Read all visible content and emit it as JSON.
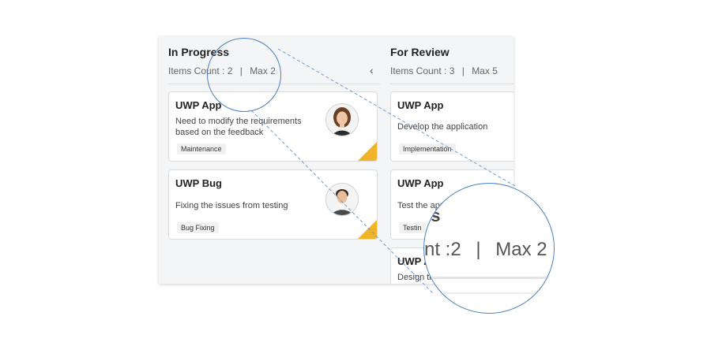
{
  "columns": [
    {
      "title": "In Progress",
      "count_label": "Items Count : 2",
      "separator": "|",
      "max_label": "Max 2",
      "cards": [
        {
          "title": "UWP App",
          "desc_lines": [
            "Need to modify the requirements",
            "based on the feedback"
          ],
          "tag": "Maintenance",
          "avatar": "female-avatar"
        },
        {
          "title": "UWP Bug",
          "desc_lines": [
            "Fixing the issues from testing"
          ],
          "tag": "Bug Fixing",
          "avatar": "male-avatar"
        }
      ]
    },
    {
      "title": "For Review",
      "count_label": "Items Count : 3",
      "separator": "|",
      "max_label": "Max 5",
      "cards": [
        {
          "title": "UWP App",
          "desc_lines": [
            "Develop the application"
          ],
          "tag": "Implementation"
        },
        {
          "title": "UWP App",
          "desc_lines": [
            "Test the applic"
          ],
          "tag": "Testin"
        },
        {
          "title": "UWP A",
          "desc_lines": [
            "Design th"
          ]
        }
      ]
    }
  ],
  "chevron_icon": "chevron-left-icon",
  "magnifier": {
    "title_fragment": "ss",
    "count_fragment": "nt :2",
    "separator": "|",
    "max_label": "Max 2"
  },
  "colors": {
    "accent_corner": "#f0b429",
    "magnifier_stroke": "#4a7fc1",
    "board_bg": "#f4f5f7"
  }
}
